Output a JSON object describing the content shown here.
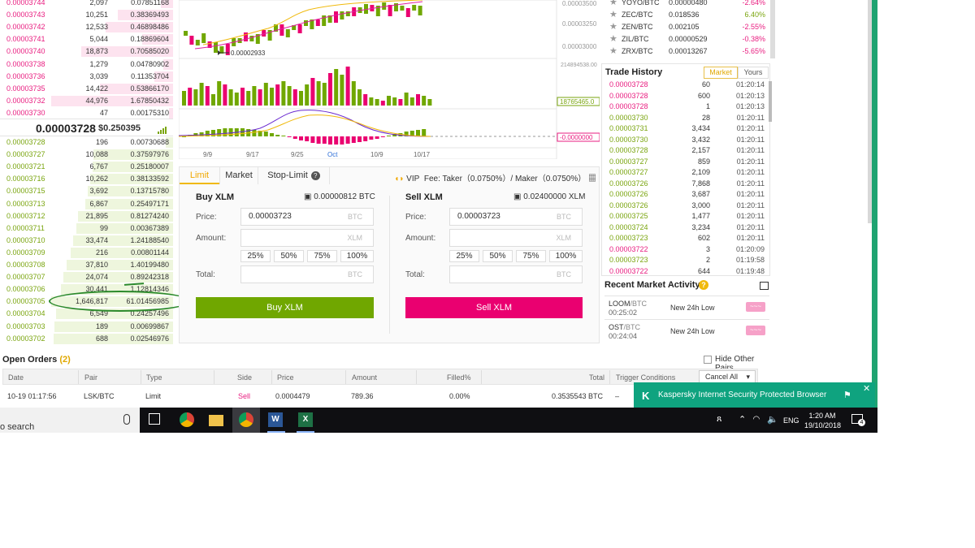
{
  "orderbook": {
    "asks": [
      {
        "price": "0.00003744",
        "amount": "2,097",
        "total": "0.07851168",
        "depth": 0.1
      },
      {
        "price": "0.00003743",
        "amount": "10,251",
        "total": "0.38369493",
        "depth": 0.45
      },
      {
        "price": "0.00003742",
        "amount": "12,533",
        "total": "0.46898486",
        "depth": 0.55
      },
      {
        "price": "0.00003741",
        "amount": "5,044",
        "total": "0.18869604",
        "depth": 0.25
      },
      {
        "price": "0.00003740",
        "amount": "18,873",
        "total": "0.70585020",
        "depth": 0.75
      },
      {
        "price": "0.00003738",
        "amount": "1,279",
        "total": "0.04780902",
        "depth": 0.08
      },
      {
        "price": "0.00003736",
        "amount": "3,039",
        "total": "0.11353704",
        "depth": 0.15
      },
      {
        "price": "0.00003735",
        "amount": "14,422",
        "total": "0.53866170",
        "depth": 0.6
      },
      {
        "price": "0.00003732",
        "amount": "44,976",
        "total": "1.67850432",
        "depth": 1.0
      },
      {
        "price": "0.00003730",
        "amount": "47",
        "total": "0.00175310",
        "depth": 0.03
      }
    ],
    "last_price": "0.00003728",
    "last_usd": "$0.250395",
    "bids": [
      {
        "price": "0.00003728",
        "amount": "196",
        "total": "0.00730688",
        "depth": 0.06
      },
      {
        "price": "0.00003727",
        "amount": "10,088",
        "total": "0.37597976",
        "depth": 0.65
      },
      {
        "price": "0.00003721",
        "amount": "6,767",
        "total": "0.25180007",
        "depth": 0.66
      },
      {
        "price": "0.00003716",
        "amount": "10,262",
        "total": "0.38133592",
        "depth": 0.68
      },
      {
        "price": "0.00003715",
        "amount": "3,692",
        "total": "0.13715780",
        "depth": 0.7
      },
      {
        "price": "0.00003713",
        "amount": "6,867",
        "total": "0.25497171",
        "depth": 0.72
      },
      {
        "price": "0.00003712",
        "amount": "21,895",
        "total": "0.81274240",
        "depth": 0.78
      },
      {
        "price": "0.00003711",
        "amount": "99",
        "total": "0.00367389",
        "depth": 0.79
      },
      {
        "price": "0.00003710",
        "amount": "33,474",
        "total": "1.24188540",
        "depth": 0.82
      },
      {
        "price": "0.00003709",
        "amount": "216",
        "total": "0.00801144",
        "depth": 0.84
      },
      {
        "price": "0.00003708",
        "amount": "37,810",
        "total": "1.40199480",
        "depth": 0.87
      },
      {
        "price": "0.00003707",
        "amount": "24,074",
        "total": "0.89242318",
        "depth": 0.9
      },
      {
        "price": "0.00003706",
        "amount": "30,441",
        "total": "1.12814346",
        "depth": 0.92
      },
      {
        "price": "0.00003705",
        "amount": "1,646,817",
        "total": "61.01456985",
        "depth": 1.0
      },
      {
        "price": "0.00003704",
        "amount": "6,549",
        "total": "0.24257496",
        "depth": 0.96
      },
      {
        "price": "0.00003703",
        "amount": "189",
        "total": "0.00699867",
        "depth": 0.97
      },
      {
        "price": "0.00003702",
        "amount": "688",
        "total": "0.02546976",
        "depth": 0.98
      }
    ]
  },
  "chart": {
    "price_labels": [
      "0.00003500",
      "0.00003250",
      "0.00003000"
    ],
    "low_marker": "0.00002933",
    "volume_labels": [
      "214894538.00",
      "18765465.0"
    ],
    "macd_label": "-0.0000000",
    "x_labels": [
      "9/9",
      "9/17",
      "9/25",
      "Oct",
      "10/9",
      "10/17"
    ]
  },
  "pairs": [
    {
      "name": "YOYO/BTC",
      "price": "0.00000480",
      "change": "-2.64%",
      "up": false
    },
    {
      "name": "ZEC/BTC",
      "price": "0.018536",
      "change": "6.40%",
      "up": true
    },
    {
      "name": "ZEN/BTC",
      "price": "0.002105",
      "change": "-2.55%",
      "up": false
    },
    {
      "name": "ZIL/BTC",
      "price": "0.00000529",
      "change": "-0.38%",
      "up": false
    },
    {
      "name": "ZRX/BTC",
      "price": "0.00013267",
      "change": "-5.65%",
      "up": false
    }
  ],
  "trade_history": {
    "title": "Trade History",
    "tab_market": "Market",
    "tab_yours": "Yours",
    "rows": [
      {
        "price": "0.00003728",
        "amount": "60",
        "time": "01:20:14",
        "side": "sell"
      },
      {
        "price": "0.00003728",
        "amount": "600",
        "time": "01:20:13",
        "side": "sell"
      },
      {
        "price": "0.00003728",
        "amount": "1",
        "time": "01:20:13",
        "side": "sell"
      },
      {
        "price": "0.00003730",
        "amount": "28",
        "time": "01:20:11",
        "side": "buy"
      },
      {
        "price": "0.00003731",
        "amount": "3,434",
        "time": "01:20:11",
        "side": "buy"
      },
      {
        "price": "0.00003730",
        "amount": "3,432",
        "time": "01:20:11",
        "side": "buy"
      },
      {
        "price": "0.00003728",
        "amount": "2,157",
        "time": "01:20:11",
        "side": "buy"
      },
      {
        "price": "0.00003727",
        "amount": "859",
        "time": "01:20:11",
        "side": "buy"
      },
      {
        "price": "0.00003727",
        "amount": "2,109",
        "time": "01:20:11",
        "side": "buy"
      },
      {
        "price": "0.00003726",
        "amount": "7,868",
        "time": "01:20:11",
        "side": "buy"
      },
      {
        "price": "0.00003726",
        "amount": "3,687",
        "time": "01:20:11",
        "side": "buy"
      },
      {
        "price": "0.00003726",
        "amount": "3,000",
        "time": "01:20:11",
        "side": "buy"
      },
      {
        "price": "0.00003725",
        "amount": "1,477",
        "time": "01:20:11",
        "side": "buy"
      },
      {
        "price": "0.00003724",
        "amount": "3,234",
        "time": "01:20:11",
        "side": "buy"
      },
      {
        "price": "0.00003723",
        "amount": "602",
        "time": "01:20:11",
        "side": "buy"
      },
      {
        "price": "0.00003722",
        "amount": "3",
        "time": "01:20:09",
        "side": "sell"
      },
      {
        "price": "0.00003723",
        "amount": "2",
        "time": "01:19:58",
        "side": "buy"
      },
      {
        "price": "0.00003722",
        "amount": "644",
        "time": "01:19:48",
        "side": "sell"
      }
    ]
  },
  "recent_activity": {
    "title": "Recent Market Activity",
    "items": [
      {
        "pair": "LOOM",
        "quote": "/BTC",
        "time": "00:25:02",
        "label": "New 24h Low"
      },
      {
        "pair": "OST",
        "quote": "/BTC",
        "time": "00:24:04",
        "label": "New 24h Low"
      }
    ]
  },
  "form": {
    "tabs": {
      "limit": "Limit",
      "market": "Market",
      "stop": "Stop-Limit"
    },
    "vip": "VIP",
    "fee": "Fee: Taker（0.0750%）/ Maker（0.0750%）",
    "buy": {
      "title": "Buy XLM",
      "balance": "0.00000812 BTC",
      "price": "0.00003723",
      "price_unit": "BTC",
      "amount_unit": "XLM",
      "total_unit": "BTC",
      "button": "Buy XLM"
    },
    "sell": {
      "title": "Sell XLM",
      "balance": "0.02400000 XLM",
      "price": "0.00003723",
      "price_unit": "BTC",
      "amount_unit": "XLM",
      "total_unit": "BTC",
      "button": "Sell XLM"
    },
    "labels": {
      "price": "Price:",
      "amount": "Amount:",
      "total": "Total:"
    },
    "pcts": [
      "25%",
      "50%",
      "75%",
      "100%"
    ]
  },
  "open_orders": {
    "title": "Open Orders",
    "count": "(2)",
    "hide_label": "Hide Other Pairs",
    "headers": [
      "Date",
      "Pair",
      "Type",
      "Side",
      "Price",
      "Amount",
      "Filled%",
      "Total",
      "Trigger Conditions"
    ],
    "cancel_all": "Cancel All",
    "row": {
      "date": "10-19 01:17:56",
      "pair": "LSK/BTC",
      "type": "Limit",
      "side": "Sell",
      "price": "0.0004479",
      "amount": "789.36",
      "filled": "0.00%",
      "total": "0.3535543 BTC",
      "trigger": "–"
    }
  },
  "kaspersky": {
    "text": "Kaspersky Internet Security Protected Browser"
  },
  "taskbar": {
    "search": "o search",
    "lang": "ENG",
    "time": "1:20 AM",
    "date": "19/10/2018",
    "notif": "4"
  },
  "colors": {
    "buy": "#70a700",
    "sell": "#ea0070",
    "accent": "#f0b90b"
  }
}
